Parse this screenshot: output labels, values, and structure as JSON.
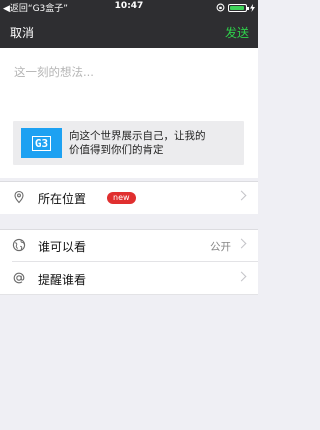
{
  "status_bar": {
    "back_text": "◀返回“G3盒子”",
    "time": "10:47",
    "battery_level": 0.95
  },
  "nav": {
    "cancel_label": "取消",
    "send_label": "发送"
  },
  "compose": {
    "placeholder": "这一刻的想法...",
    "share_card": {
      "logo_text": "G3",
      "line1": "向这个世界展示自己，让我的",
      "line2": "价值得到你们的肯定"
    }
  },
  "location": {
    "label": "所在位置",
    "badge": "new"
  },
  "visibility": {
    "label": "谁可以看",
    "value": "公开"
  },
  "remind": {
    "label": "提醒谁看"
  },
  "colors": {
    "accent_green": "#2fd04b",
    "badge_red": "#e02f2f",
    "logo_blue": "#1da1f2"
  }
}
